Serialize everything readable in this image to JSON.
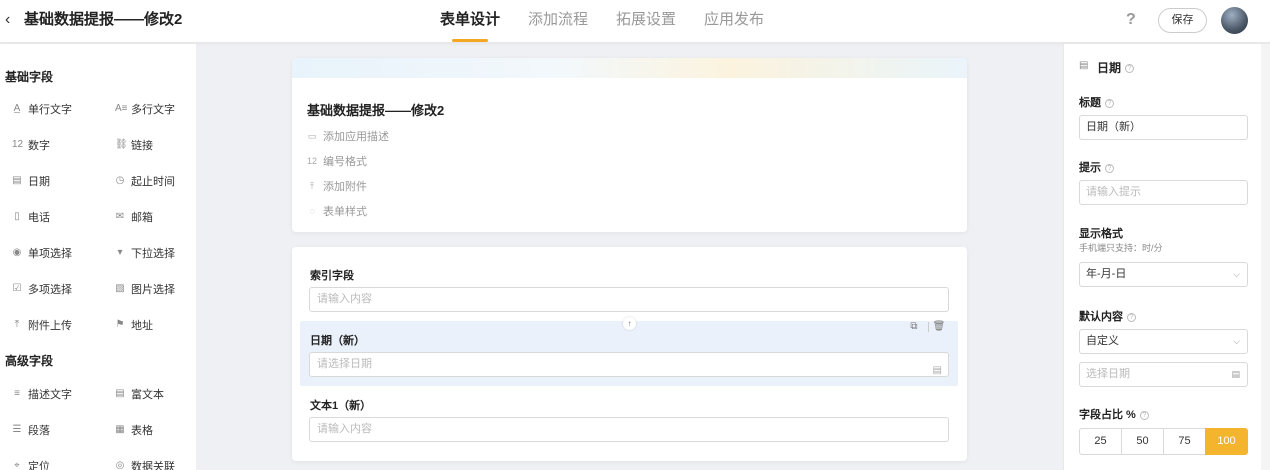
{
  "header": {
    "back_icon": "chevron-left-icon",
    "title": "基础数据提报——修改2",
    "tabs": [
      {
        "label": "表单设计",
        "active": true
      },
      {
        "label": "添加流程",
        "active": false
      },
      {
        "label": "拓展设置",
        "active": false
      },
      {
        "label": "应用发布",
        "active": false
      }
    ],
    "help_icon": "?",
    "save_label": "保存",
    "accent": "#f5a623"
  },
  "left": {
    "basic_title": "基础字段",
    "basic_fields": [
      {
        "label": "单行文字",
        "icon": "A̲"
      },
      {
        "label": "多行文字",
        "icon": "A≡"
      },
      {
        "label": "数字",
        "icon": "12"
      },
      {
        "label": "链接",
        "icon": "⛓"
      },
      {
        "label": "日期",
        "icon": "▤"
      },
      {
        "label": "起止时间",
        "icon": "◷"
      },
      {
        "label": "电话",
        "icon": "▯"
      },
      {
        "label": "邮箱",
        "icon": "✉"
      },
      {
        "label": "单项选择",
        "icon": "◉"
      },
      {
        "label": "下拉选择",
        "icon": "▾"
      },
      {
        "label": "多项选择",
        "icon": "☑"
      },
      {
        "label": "图片选择",
        "icon": "▧"
      },
      {
        "label": "附件上传",
        "icon": "⤒"
      },
      {
        "label": "地址",
        "icon": "⚑"
      }
    ],
    "advanced_title": "高级字段",
    "advanced_fields": [
      {
        "label": "描述文字",
        "icon": "≡"
      },
      {
        "label": "富文本",
        "icon": "▤"
      },
      {
        "label": "段落",
        "icon": "☰"
      },
      {
        "label": "表格",
        "icon": "▦"
      },
      {
        "label": "定位",
        "icon": "⌖"
      },
      {
        "label": "数据关联",
        "icon": "◎"
      }
    ]
  },
  "form": {
    "title": "基础数据提报——修改2",
    "meta": [
      {
        "label": "添加应用描述",
        "icon": "▭"
      },
      {
        "label": "编号格式",
        "icon": "12"
      },
      {
        "label": "添加附件",
        "icon": "⤒"
      },
      {
        "label": "表单样式",
        "icon": "◌"
      }
    ],
    "fields": [
      {
        "label": "索引字段",
        "placeholder": "请输入内容"
      },
      {
        "label": "日期（新）",
        "placeholder": "请选择日期"
      },
      {
        "label": "文本1（新）",
        "placeholder": "请输入内容"
      }
    ],
    "move_up_icon": "↑",
    "copy_icon": "⧉",
    "delete_icon": "🗑",
    "calendar_icon": "▤"
  },
  "right": {
    "header_icon": "▤",
    "header": "日期",
    "title_label": "标题",
    "title_value": "日期（新）",
    "hint_label": "提示",
    "hint_placeholder": "请输入提示",
    "format_label": "显示格式",
    "format_sub": "手机端只支持：时/分",
    "format_value": "年-月-日",
    "default_label": "默认内容",
    "default_value": "自定义",
    "date_placeholder": "选择日期",
    "ratio_label": "字段占比 %",
    "ratio_options": [
      "25",
      "50",
      "75",
      "100"
    ],
    "ratio_selected": "100"
  }
}
